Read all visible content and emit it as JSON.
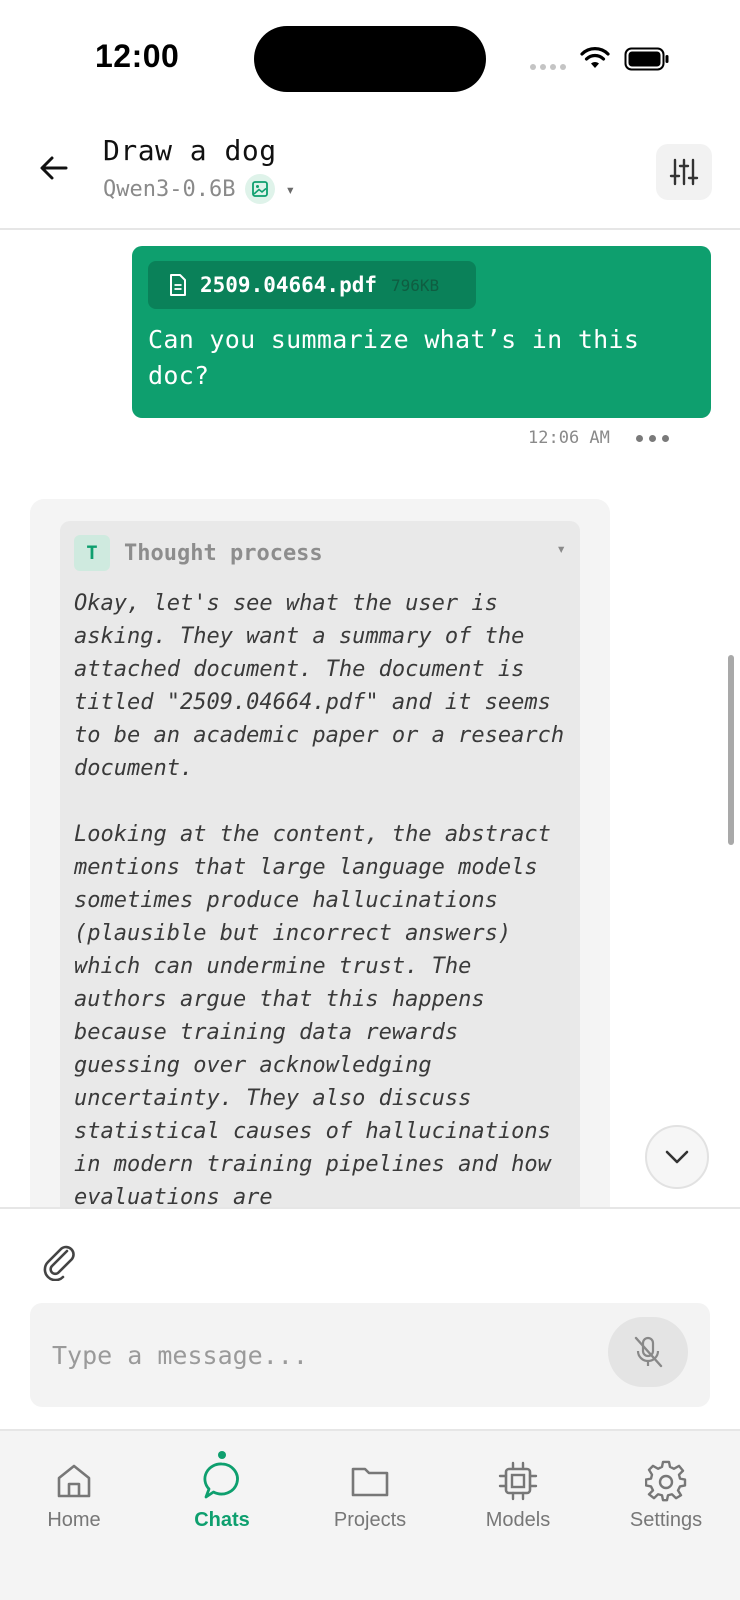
{
  "status_bar": {
    "time": "12:00"
  },
  "header": {
    "title": "Draw a dog",
    "model": "Qwen3-0.6B",
    "caret": "▾"
  },
  "messages": {
    "user": {
      "attachment_name": "2509.04664.pdf",
      "attachment_size": "796KB",
      "text": "Can you summarize what’s in this doc?",
      "time": "12:06 AM"
    },
    "assistant": {
      "avatar_letter": "T",
      "thought_title": "Thought process",
      "thought_caret": "▾",
      "paragraphs": [
        "Okay, let's see what the user is asking. They want a summary of the attached document. The document is titled \"2509.04664.pdf\" and it seems to be an academic paper or a research document.",
        "Looking at the content, the abstract mentions that large language models sometimes produce hallucinations (plausible but incorrect answers) which can undermine trust. The authors argue that this happens because training data rewards guessing over acknowledging uncertainty. They also discuss statistical causes of hallucinations in modern training pipelines and how evaluations are"
      ]
    }
  },
  "composer": {
    "placeholder": "Type a message..."
  },
  "tabs": [
    {
      "label": "Home",
      "icon": "home-icon",
      "active": false
    },
    {
      "label": "Chats",
      "icon": "chat-bubble-icon",
      "active": true
    },
    {
      "label": "Projects",
      "icon": "folder-icon",
      "active": false
    },
    {
      "label": "Models",
      "icon": "chip-icon",
      "active": false
    },
    {
      "label": "Settings",
      "icon": "gear-icon",
      "active": false
    }
  ],
  "colors": {
    "accent": "#0e9f6e",
    "user_bubble": "#0e9f6e",
    "attachment_chip": "#0a8159",
    "thought_bg": "#e9e9e9"
  }
}
